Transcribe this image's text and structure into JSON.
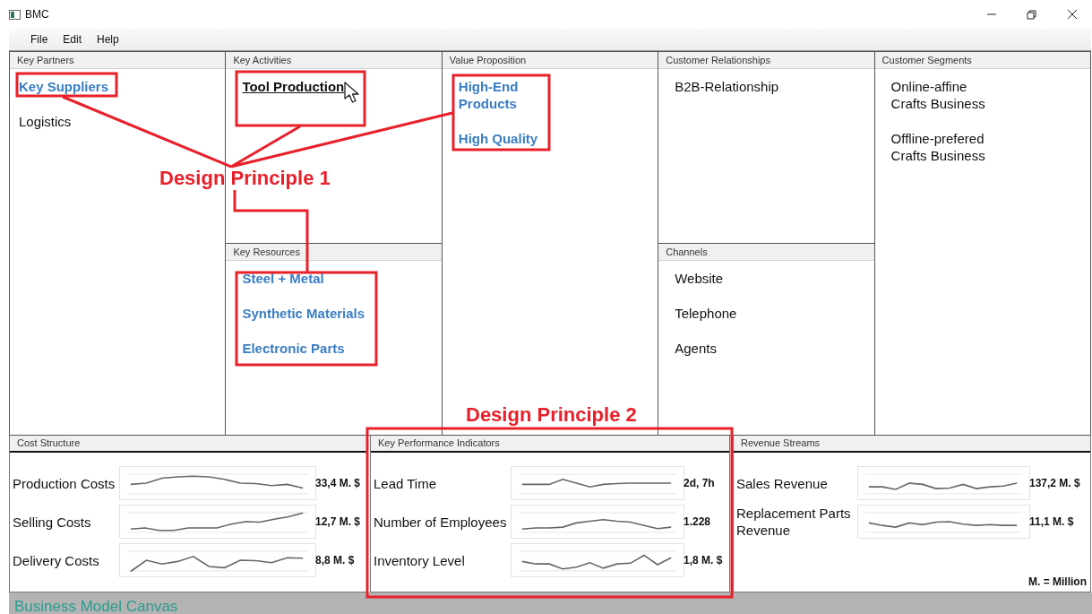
{
  "window": {
    "title": "BMC"
  },
  "menu": [
    "File",
    "Edit",
    "Help"
  ],
  "blocks": [
    {
      "title": "Key Partners",
      "items": [
        {
          "text": "Key Suppliers",
          "kind": "link"
        },
        {
          "text": "Logistics",
          "kind": "text"
        }
      ]
    },
    {
      "title": "Key Activities",
      "items": [
        {
          "text": "Tool Production",
          "kind": "hover-link"
        }
      ]
    },
    {
      "title": "Key Resources",
      "items": [
        {
          "text": "Steel + Metal",
          "kind": "link"
        },
        {
          "text": "Synthetic Materials",
          "kind": "link"
        },
        {
          "text": "Electronic Parts",
          "kind": "link"
        }
      ]
    },
    {
      "title": "Value Proposition",
      "items": [
        {
          "text": "High-End\nProducts",
          "kind": "link"
        },
        {
          "text": "High Quality",
          "kind": "link"
        }
      ]
    },
    {
      "title": "Customer Relationships",
      "items": [
        {
          "text": "B2B-Relationship",
          "kind": "text"
        }
      ]
    },
    {
      "title": "Channels",
      "items": [
        {
          "text": "Website",
          "kind": "text"
        },
        {
          "text": "Telephone",
          "kind": "text"
        },
        {
          "text": "Agents",
          "kind": "text"
        }
      ]
    },
    {
      "title": "Customer Segments",
      "items": [
        {
          "text": "Online-affine\nCrafts Business",
          "kind": "text"
        },
        {
          "text": "Offline-prefered\nCrafts Business",
          "kind": "text"
        }
      ]
    }
  ],
  "metric_panels": [
    {
      "title": "Cost Structure",
      "rows": [
        {
          "label": "Production Costs",
          "value": "33,4 M. $"
        },
        {
          "label": "Selling Costs",
          "value": "12,7 M. $"
        },
        {
          "label": "Delivery Costs",
          "value": "8,8 M. $"
        }
      ]
    },
    {
      "title": "Key Performance Indicators",
      "rows": [
        {
          "label": "Lead Time",
          "value": "2d, 7h"
        },
        {
          "label": "Number of Employees",
          "value": "1.228"
        },
        {
          "label": "Inventory Level",
          "value": "1,8 M. $"
        }
      ]
    },
    {
      "title": "Revenue Streams",
      "rows": [
        {
          "label": "Sales Revenue",
          "value": "137,2 M. $"
        },
        {
          "label": "Replacement Parts Revenue",
          "value": "11,1 M. $"
        }
      ],
      "note": "M. = Million"
    }
  ],
  "annotations": [
    {
      "label": "Design Principle 1"
    },
    {
      "label": "Design Principle 2"
    }
  ],
  "status_bar": "Business Model Canvas"
}
